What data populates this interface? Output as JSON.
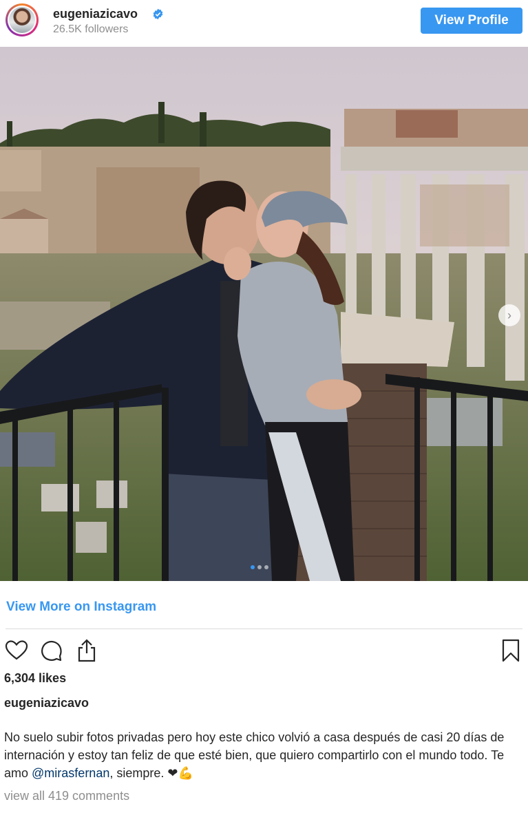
{
  "header": {
    "username": "eugeniazicavo",
    "followers": "26.5K followers",
    "view_profile_label": "View Profile"
  },
  "carousel": {
    "slide_count": 3,
    "active_slide": 1
  },
  "view_more_label": "View More on Instagram",
  "likes": "6,304 likes",
  "caption": {
    "username": "eugeniazicavo",
    "text_before_mention": "No suelo subir fotos privadas pero hoy este chico volvió a casa después de casi 20 días de internación y estoy tan feliz de que esté bien, que quiero compartirlo con el mundo todo. Te amo ",
    "mention": "@mirasfernan",
    "text_after_mention": ", siempre. ❤💪"
  },
  "view_comments": "view all 419 comments",
  "colors": {
    "accent": "#3897f0",
    "text": "#262626",
    "muted": "#8e8e8e"
  },
  "icons": [
    "verified-badge-icon",
    "heart-icon",
    "comment-icon",
    "share-icon",
    "bookmark-icon",
    "chevron-right-icon"
  ]
}
